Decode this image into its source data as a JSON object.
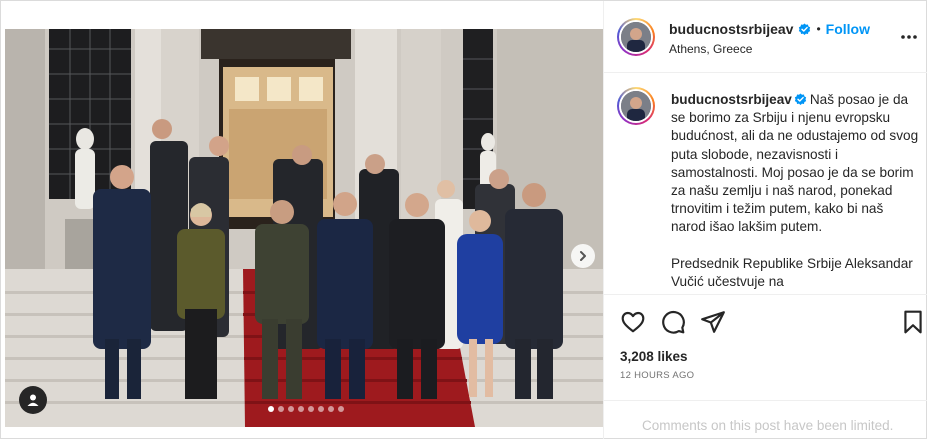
{
  "post": {
    "username": "buducnostsrbijeav",
    "follow_label": "Follow",
    "separator": "•",
    "location": "Athens, Greece",
    "caption_text": "Naš posao je da se borimo za Srbiju i njenu evropsku budućnost, ali da ne odustajemo od svog puta slobode, nezavisnosti i samostalnosti. Moj posao je da se borim za našu zemlju i naš narod, ponekad trnovitim i težim putem, kako bi naš narod išao lakšim putem.\n\nPredsednik Republike Srbije Aleksandar Vučić učestvuje na",
    "likes": "3,208 likes",
    "timestamp": "12 HOURS AGO",
    "comments_notice": "Comments on this post have been limited."
  },
  "carousel": {
    "slide_count": 8,
    "active_index": 0
  },
  "icons": {
    "verified": "verified-badge-icon",
    "more": "more-options-icon",
    "like": "heart-icon",
    "comment": "comment-icon",
    "share": "share-icon",
    "save": "bookmark-icon",
    "next": "chevron-right-icon",
    "tag": "user-tag-icon"
  },
  "colors": {
    "follow": "#0095f6",
    "verified": "#0095f6",
    "text": "#262626",
    "muted": "#737373",
    "limited": "#c7c7c7",
    "carpet": "#9e1a1e"
  }
}
